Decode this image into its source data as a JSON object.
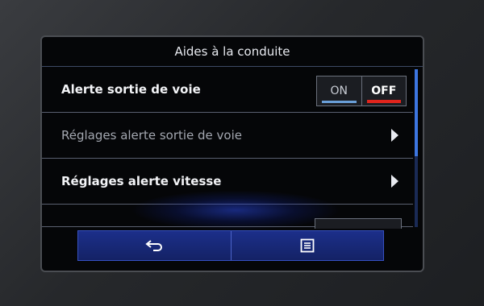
{
  "screen": {
    "title": "Aides à la conduite"
  },
  "settings": {
    "items": [
      {
        "label": "Alerte sortie de voie",
        "toggle": {
          "on_label": "ON",
          "off_label": "OFF",
          "selected": "OFF"
        }
      },
      {
        "label": "Réglages alerte sortie de voie",
        "enabled": false
      },
      {
        "label": "Réglages alerte vitesse",
        "enabled": true
      }
    ]
  },
  "bottom_bar": {
    "buttons": [
      {
        "icon": "back-arrow-icon"
      },
      {
        "icon": "menu-list-icon"
      }
    ]
  },
  "colors": {
    "accent_blue": "#3d76e0",
    "off_red": "#e0241c",
    "bar_blue": "#1c2f8a"
  }
}
